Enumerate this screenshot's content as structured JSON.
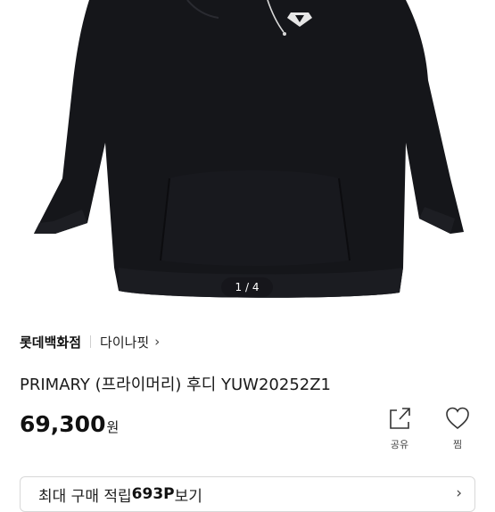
{
  "gallery": {
    "pager": "1 / 4",
    "image_alt": "black hoodie"
  },
  "store": {
    "name": "롯데백화점",
    "brand": "다이나핏",
    "chevron": "›"
  },
  "product": {
    "title": "PRIMARY (프라이머리) 후디 YUW20252Z1",
    "price": "69,300",
    "price_unit": "원"
  },
  "actions": {
    "share_label": "공유",
    "like_label": "찜",
    "share_icon": "share-icon",
    "like_icon": "heart-icon"
  },
  "points_banner": {
    "prefix": "최대 구매 적립 ",
    "amount": "693P",
    "suffix": "보기",
    "chevron": "›"
  },
  "colors": {
    "hoodie": "#15161a",
    "border": "#d8d8d8"
  }
}
